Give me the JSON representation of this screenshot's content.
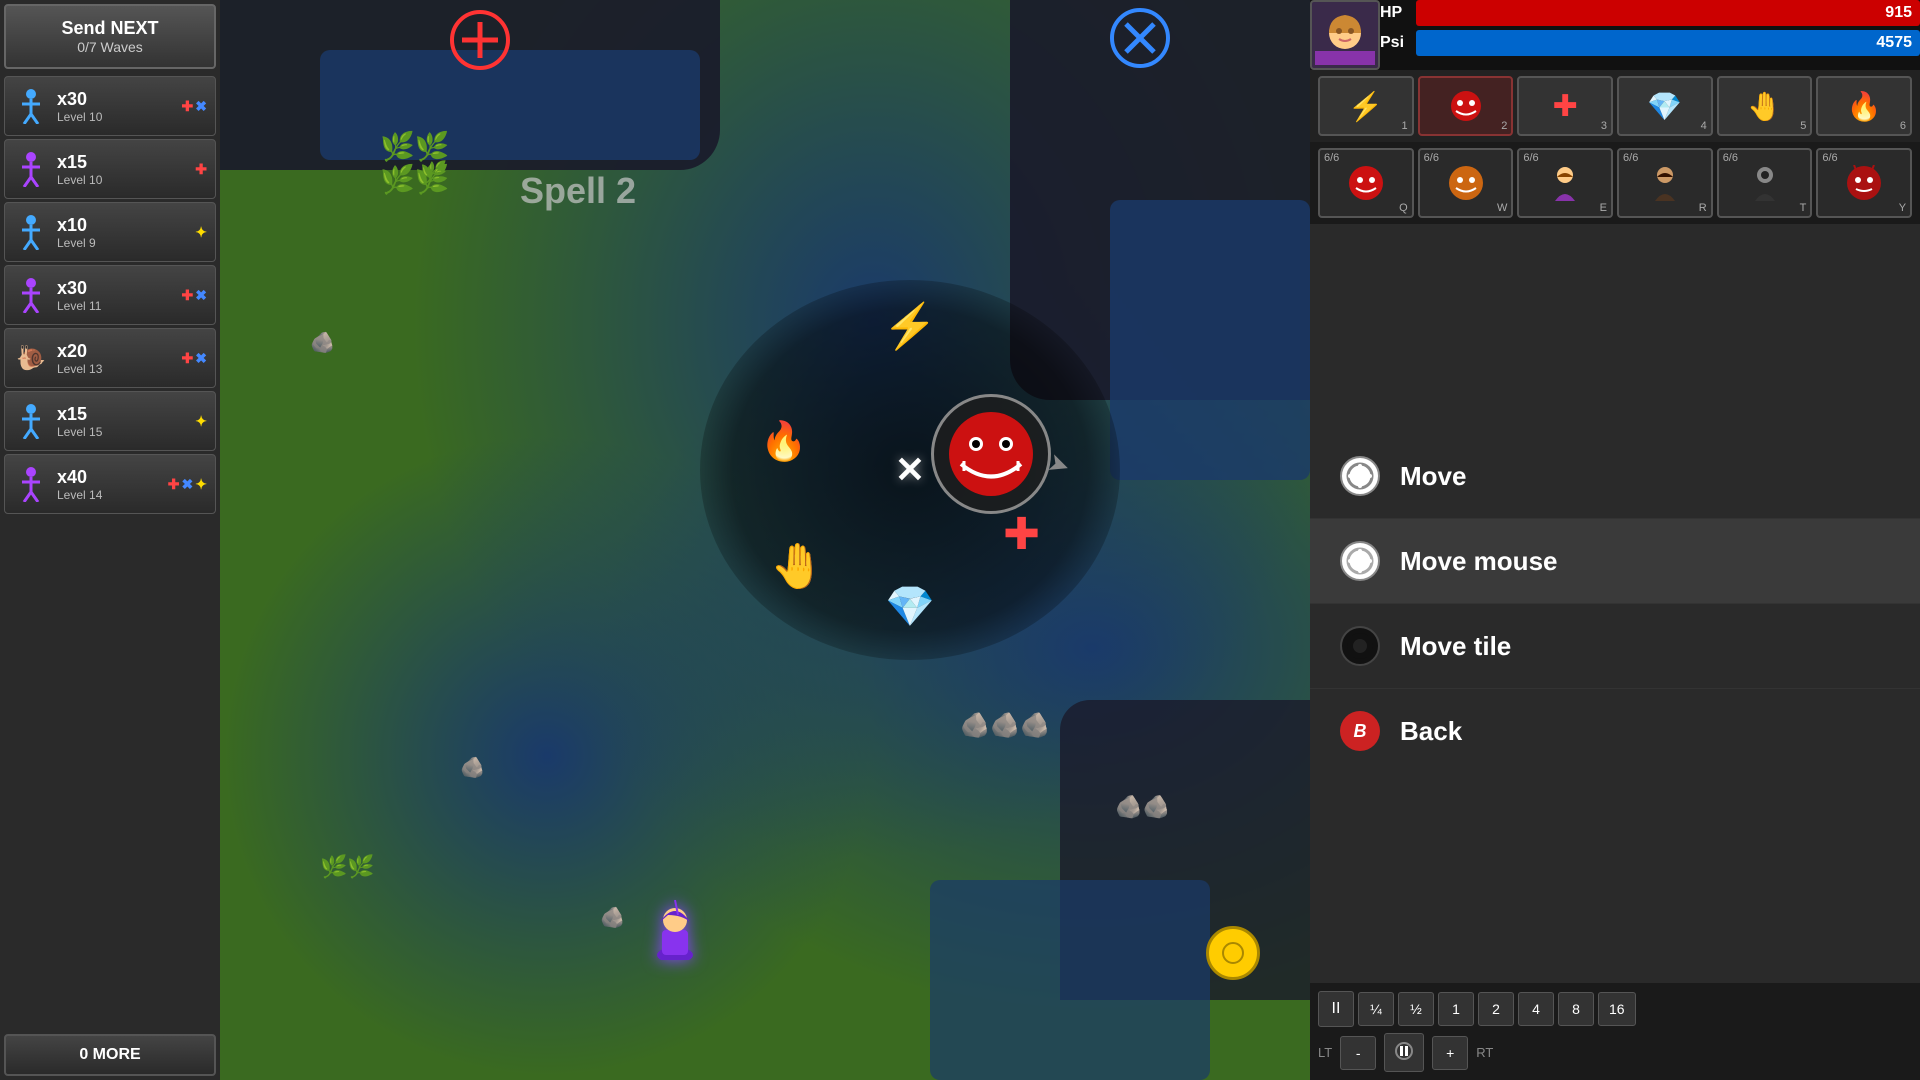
{
  "header": {
    "send_next_label": "Send NEXT",
    "waves_label": "0/7 Waves",
    "more_label": "0 MORE"
  },
  "units": [
    {
      "count": "x30",
      "level": "Level 10",
      "badges": [
        "red_plus",
        "blue_x"
      ],
      "type": "blue"
    },
    {
      "count": "x15",
      "level": "Level 10",
      "badges": [
        "red_plus"
      ],
      "type": "purple"
    },
    {
      "count": "x10",
      "level": "Level 9",
      "badges": [
        "yellow_dot"
      ],
      "type": "blue"
    },
    {
      "count": "x30",
      "level": "Level 11",
      "badges": [
        "red_plus",
        "blue_x"
      ],
      "type": "purple"
    },
    {
      "count": "x20",
      "level": "Level 13",
      "badges": [
        "red_plus",
        "blue_x"
      ],
      "type": "snail"
    },
    {
      "count": "x15",
      "level": "Level 15",
      "badges": [
        "yellow_dot"
      ],
      "type": "blue"
    },
    {
      "count": "x40",
      "level": "Level 14",
      "badges": [
        "red_plus",
        "blue_x",
        "yellow_dot"
      ],
      "type": "purple"
    }
  ],
  "player": {
    "hp_label": "HP",
    "hp_value": "915",
    "psi_label": "Psi",
    "psi_value": "4575"
  },
  "spell_slots": [
    {
      "icon": "⚡",
      "num": "1"
    },
    {
      "icon": "😈",
      "num": "2"
    },
    {
      "icon": "➕",
      "num": "3",
      "color": "red"
    },
    {
      "icon": "💎",
      "num": "4"
    },
    {
      "icon": "🤚",
      "num": "5"
    },
    {
      "icon": "🔥",
      "num": "6"
    }
  ],
  "char_slots": [
    {
      "count": "6/6",
      "key": "Q",
      "icon": "😈",
      "color": "red"
    },
    {
      "count": "6/6",
      "key": "W",
      "icon": "😈",
      "color": "brown"
    },
    {
      "count": "6/6",
      "key": "E",
      "icon": "👩",
      "color": "blonde"
    },
    {
      "count": "6/6",
      "key": "R",
      "icon": "👧",
      "color": "dark"
    },
    {
      "count": "6/6",
      "key": "T",
      "icon": "🧟",
      "color": "dark"
    },
    {
      "count": "6/6",
      "key": "Y",
      "icon": "😈",
      "color": "red2"
    }
  ],
  "actions": [
    {
      "label": "Move",
      "icon_type": "white_ring"
    },
    {
      "label": "Move mouse",
      "icon_type": "white_ring"
    },
    {
      "label": "Move tile",
      "icon_type": "dark_circle"
    },
    {
      "label": "Back",
      "icon_type": "b_button"
    }
  ],
  "speed_controls": [
    "II",
    "¼",
    "½",
    "1",
    "2",
    "4",
    "8",
    "16"
  ],
  "bottom_extra": {
    "lt_label": "LT",
    "minus_label": "-",
    "pause_icon": "⏸",
    "plus_label": "+",
    "rt_label": "RT"
  },
  "map": {
    "spell_label": "Spell 2",
    "plus_btn": "⊕",
    "x_btn": "⊗"
  }
}
